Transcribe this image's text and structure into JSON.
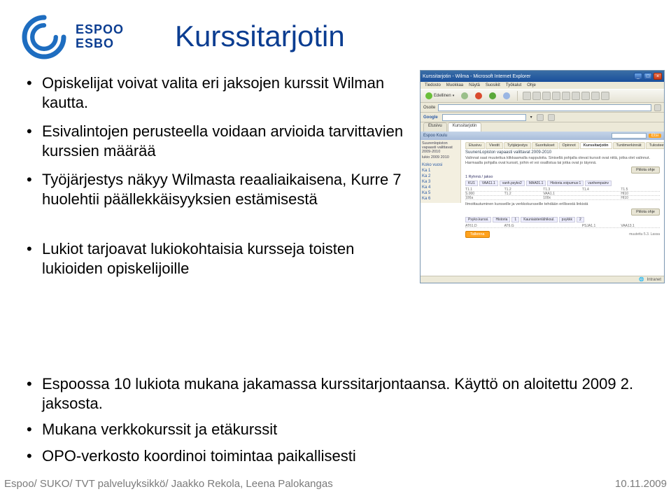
{
  "logo": {
    "line1": "ESPOO",
    "line2": "ESBO"
  },
  "title": "Kurssitarjotin",
  "bullets_top": [
    "Opiskelijat voivat valita eri jaksojen kurssit Wilman kautta.",
    "Esivalintojen perusteella voidaan arvioida tarvittavien kurssien määrää",
    "Työjärjestys näkyy Wilmasta reaaliaikaisena, Kurre 7 huolehtii päällekkäisyyksien estämisestä"
  ],
  "bullets_mid": [
    "Lukiot tarjoavat lukiokohtaisia kursseja toisten lukioiden opiskelijoille"
  ],
  "bullets_bottom": [
    "Espoossa 10 lukiota mukana jakamassa kurssitarjontaansa. Käyttö on aloitettu 2009 2. jaksosta.",
    "Mukana verkkokurssit ja etäkurssit",
    "OPO-verkosto koordinoi toimintaa paikallisesti"
  ],
  "footer": {
    "left": "Espoo/ SUKO/ TVT palveluyksikkö/ Jaakko Rekola, Leena Palokangas",
    "right": "10.11.2009"
  },
  "screenshot": {
    "window_title": "Kurssitarjotin - Wilma - Microsoft Internet Explorer",
    "menubar": [
      "Tiedosto",
      "Muokkaa",
      "Näytä",
      "Suosikit",
      "Työkalut",
      "Ohje"
    ],
    "toolbar": {
      "back": "Edellinen"
    },
    "googlebar": {
      "label": "Google"
    },
    "page_tabs": [
      "Etusivu",
      "Kurssitarjotin"
    ],
    "bluebar": {
      "left": "Espoo Koulu",
      "searchbtn": "Etsi"
    },
    "side_header": "Suurenlopiston vapaasti valittavat 2009-2010",
    "side_sub": "lukio 2009 2010",
    "side_items": [
      "Koko vuosi",
      "Ka 1",
      "Ka 2",
      "Ka 3",
      "Ka 4",
      "Ka 5",
      "Ka 6"
    ],
    "subtabs": [
      "Etusivu",
      "Viestit",
      "Työjärjestys",
      "Suoritukset",
      "Opinnot",
      "Kurssitarjotin",
      "Tuntimerkinnät",
      "Tulosteet"
    ],
    "main_title": "SuunenLopiston vapaasti valittavat 2009-2010",
    "main_para": "Valinnat saat muutettua klikkaamalla nappuloita. Sinisellä pohjalla olevat kurssit ovat niitä, jotka olet valinnut. Harmaalla pohjalla ovat kurssit, joihin et voi osallistua tai jotka ovat jo täynnä.",
    "btn_piilota": "Piilota ohje",
    "section1": "1 Ryhmä / jakso",
    "tagrow": [
      "KU1",
      "VAA11.1",
      "vanh.psyko2",
      "MAA01.1",
      "Historia.voipumus:1",
      "vanhempainv"
    ],
    "gridhdr": [
      "T1.1",
      "T1.2",
      "T1.3",
      "T1.4",
      "T1.5"
    ],
    "row1": [
      "S.000",
      "T1.2",
      "VAA1.1",
      "",
      "HI10"
    ],
    "row2": [
      "100a",
      "",
      "100x",
      "",
      "HI10"
    ],
    "section2": "Ilmoittautuminen kursseille ja verkkokursseille tehdään erillisestä linkistä",
    "btn_piilota2": "Piilota ohje",
    "tagrow2": [
      "Psyko.kurssi.",
      "Historia",
      "1",
      "Kauniaistenlähikoul.",
      "psykkk",
      "2"
    ],
    "row3": [
      "AT61.D",
      "AT6.G",
      "",
      "PSJA1.1",
      "VAA13.1"
    ],
    "foot_left_btn": "Tallenna",
    "foot_right": "muutettu 5.3. Lassa",
    "statusbar": "Intranet"
  }
}
